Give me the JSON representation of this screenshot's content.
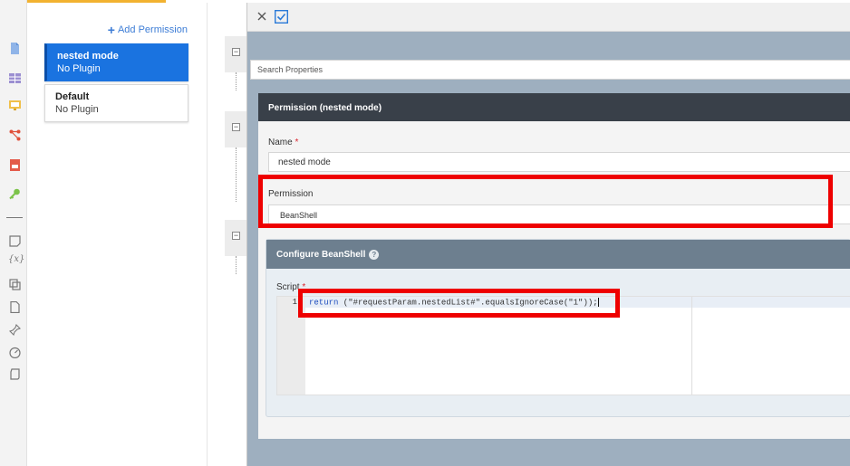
{
  "rail": {
    "icons": [
      "document-icon",
      "table-icon",
      "monitor-icon",
      "workflow-icon",
      "report-icon",
      "key-icon",
      "note-icon",
      "variable-icon",
      "plugin-icon",
      "page-icon",
      "pin-icon",
      "gauge-icon",
      "log-icon"
    ],
    "variable_glyph": "{x}"
  },
  "permission_list": {
    "add_label": "Add Permission",
    "items": [
      {
        "name": "nested mode",
        "plugin": "No Plugin",
        "active": true
      },
      {
        "name": "Default",
        "plugin": "No Plugin",
        "active": false
      }
    ]
  },
  "properties": {
    "search_placeholder": "Search Properties",
    "section_title": "Permission (nested mode)",
    "name_label": "Name",
    "name_required": "*",
    "name_value": "nested mode",
    "permission_label": "Permission",
    "permission_value": "BeanShell",
    "configure_title": "Configure BeanShell",
    "help_glyph": "?",
    "script_label": "Script",
    "script_required": "*",
    "script_line_number": "1",
    "script_keyword": "return",
    "script_rest": " (\"#requestParam.nestedList#\".equalsIgnoreCase(\"1\"));"
  },
  "colors": {
    "active_card": "#1a73e0",
    "section_header": "#394049",
    "config_header": "#6d7f8f",
    "highlight": "#ee0000",
    "accent": "#f2b230"
  }
}
